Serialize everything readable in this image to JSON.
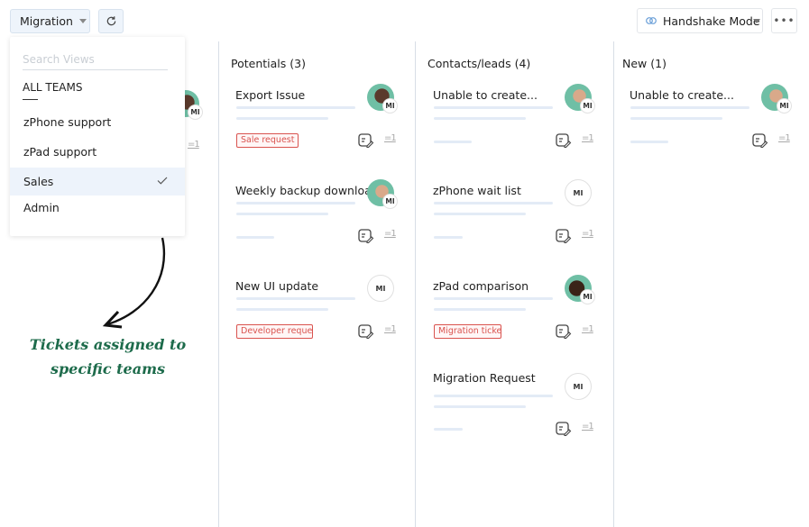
{
  "toolbar": {
    "view_selector": "Migration",
    "refresh_icon": "refresh-icon",
    "mode_selector": "Handshake Mode",
    "mode_icon": "handshake-icon",
    "more_label": "•••"
  },
  "view_dropdown": {
    "search_placeholder": "Search Views",
    "group_label": "ALL TEAMS",
    "items": [
      {
        "label": "zPhone support",
        "selected": false
      },
      {
        "label": "zPad support",
        "selected": false
      },
      {
        "label": "Sales",
        "selected": true
      },
      {
        "label": "Admin",
        "selected": false
      }
    ]
  },
  "columns": [
    {
      "title": "Potentials (3)",
      "cards": [
        {
          "title": "Export Issue",
          "assignee": "MI",
          "avatar": "photo",
          "tag": "Sale request",
          "sub_count": "=1"
        },
        {
          "title": "Weekly backup downloa...",
          "assignee": "MI",
          "avatar": "photo",
          "tag": null,
          "sub_count": "=1"
        },
        {
          "title": "New UI update",
          "assignee": "MI",
          "avatar": "initials",
          "tag": "Developer request",
          "sub_count": "=1"
        }
      ]
    },
    {
      "title": "Contacts/leads (4)",
      "cards": [
        {
          "title": "Unable to create...",
          "assignee": "MI",
          "avatar": "photo",
          "tag": null,
          "sub_count": "=1"
        },
        {
          "title": "zPhone wait list",
          "assignee": "MI",
          "avatar": "initials",
          "tag": null,
          "sub_count": "=1"
        },
        {
          "title": "zPad comparison",
          "assignee": "MI",
          "avatar": "photo",
          "tag": "Migration ticket",
          "sub_count": "=1"
        },
        {
          "title": "Migration Request",
          "assignee": "MI",
          "avatar": "initials",
          "tag": null,
          "sub_count": "=1"
        }
      ]
    },
    {
      "title": "New (1)",
      "cards": [
        {
          "title": "Unable to create...",
          "assignee": "MI",
          "avatar": "photo",
          "tag": null,
          "sub_count": "=1"
        }
      ]
    }
  ],
  "hidden_column_card": {
    "assignee": "MI",
    "sub_count": "=1"
  },
  "annotation": {
    "text": "Tickets assigned to specific teams"
  },
  "colors": {
    "tag_red": "#d9534f",
    "annotation_green": "#1d6b4b",
    "selected_bg": "#edf3fb"
  }
}
